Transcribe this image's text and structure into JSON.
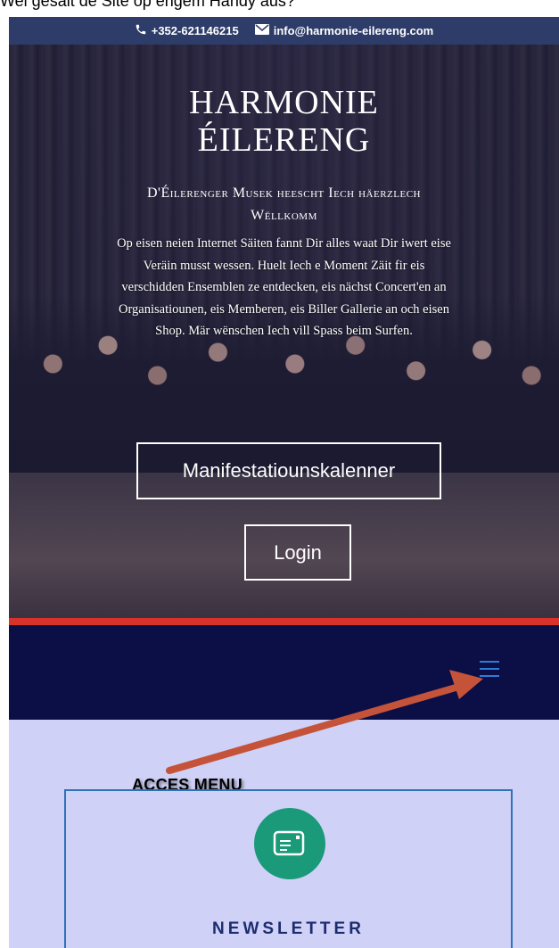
{
  "caption": "Wei gesäit de Site op engem Handy aus?",
  "topbar": {
    "phone_icon": "phone-icon",
    "phone": "+352-621146215",
    "mail_icon": "mail-icon",
    "email": "info@harmonie-eilereng.com"
  },
  "hero": {
    "title_line1": "HARMONIE",
    "title_line2": "ÉILERENG",
    "subtitle": "D'Éilerenger Musek heescht Iech häerzlech Wëllkomm",
    "paragraph": "Op eisen neien Internet Säiten fannt Dir alles waat Dir iwert eise Veräin musst wessen. Huelt Iech e Moment Zäit fir eis verschidden Ensemblen ze entdecken, eis nächst Concert'en an Organisatiounen, eis Memberen, eis Biller Gallerie an och eisen Shop. Mär wënschen Iech vill Spass beim Surfen.",
    "calendar_button": "Manifestatiounskalenner",
    "login_button": "Login"
  },
  "colors": {
    "topbar": "#2d3c68",
    "accent_line": "#d8322a",
    "nav_background": "#0b0f46",
    "hamburger": "#2f7bd8",
    "page_background": "#cfd1f7",
    "card_border": "#2f72b8",
    "newsletter_icon_bg": "#1a9a78",
    "arrow": "#c5533a"
  },
  "nav": {
    "menu_icon": "hamburger-menu-icon"
  },
  "annotation": {
    "label": "ACCES MENU"
  },
  "newsletter": {
    "icon": "newsletter-icon",
    "title": "NEWSLETTER"
  }
}
